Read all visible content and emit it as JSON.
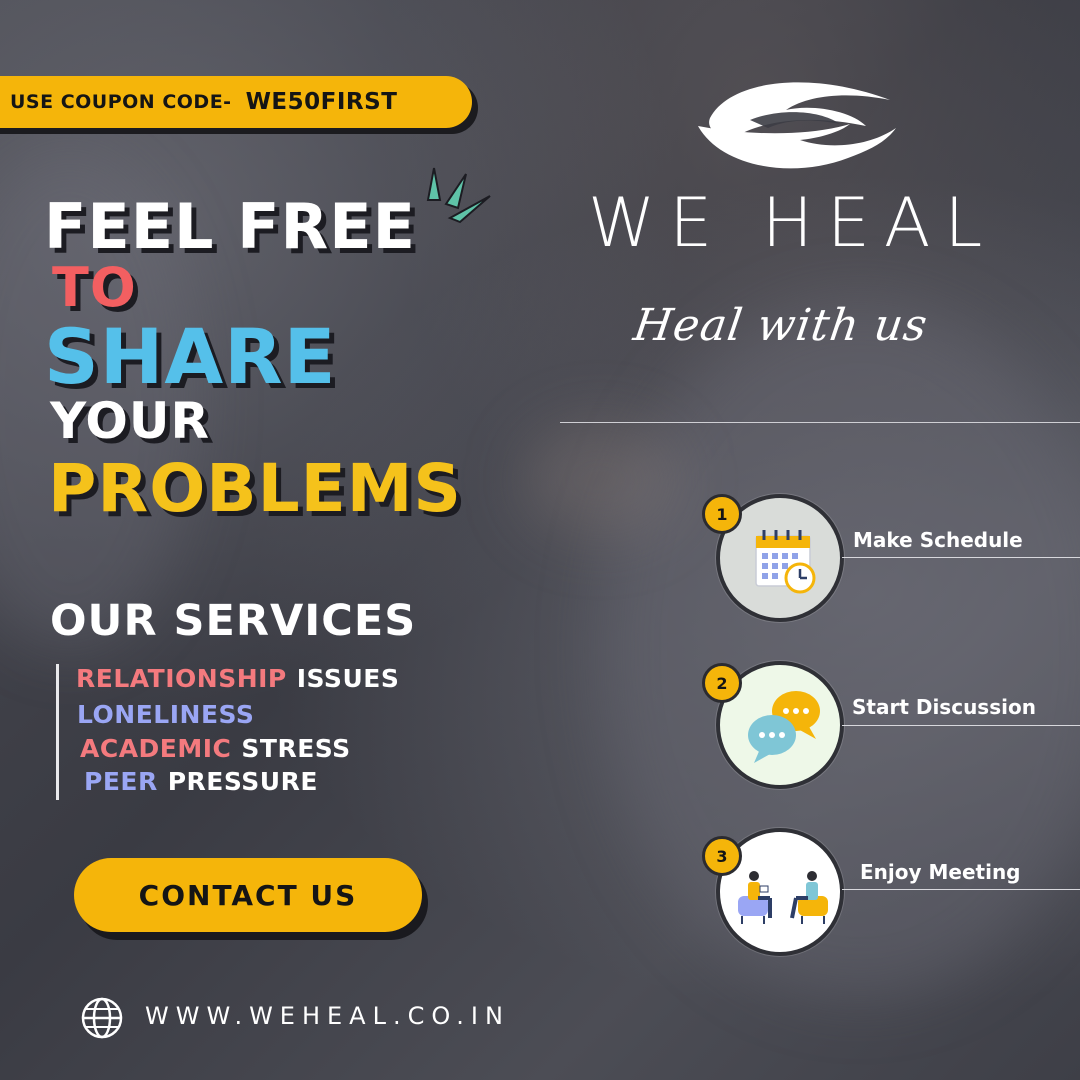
{
  "coupon": {
    "label": "USE COUPON CODE-",
    "code": "WE50FIRST"
  },
  "headline": {
    "line1": "FEEL FREE",
    "line2": "TO",
    "line3": "SHARE",
    "line4": "YOUR",
    "line5": "PROBLEMS"
  },
  "services": {
    "title": "OUR SERVICES",
    "items": [
      {
        "highlight": "RELATIONSHIP",
        "rest": "ISSUES",
        "highlight_color": "#f47a7e"
      },
      {
        "highlight": "LONELINESS",
        "rest": "",
        "highlight_color": "#9aa6f4"
      },
      {
        "highlight": "ACADEMIC",
        "rest": "STRESS",
        "highlight_color": "#f47a7e"
      },
      {
        "highlight": "PEER",
        "rest": "PRESSURE",
        "highlight_color": "#9aa6f4"
      }
    ]
  },
  "cta": {
    "label": "CONTACT US"
  },
  "website": {
    "url": "WWW.WEHEAL.CO.IN",
    "icon": "globe-icon"
  },
  "brand": {
    "name": "WE HEAL",
    "tagline": "Heal with us",
    "logo": "hands-logo"
  },
  "steps": [
    {
      "number": "1",
      "label": "Make Schedule",
      "icon": "calendar-clock-icon"
    },
    {
      "number": "2",
      "label": "Start Discussion",
      "icon": "chat-bubbles-icon"
    },
    {
      "number": "3",
      "label": "Enjoy Meeting",
      "icon": "meeting-people-icon"
    }
  ],
  "colors": {
    "accent_yellow": "#f5b50a",
    "headline_red": "#f35f61",
    "headline_blue": "#55c0ea",
    "headline_yellow": "#f5c21b",
    "background": "#3c3d45"
  }
}
